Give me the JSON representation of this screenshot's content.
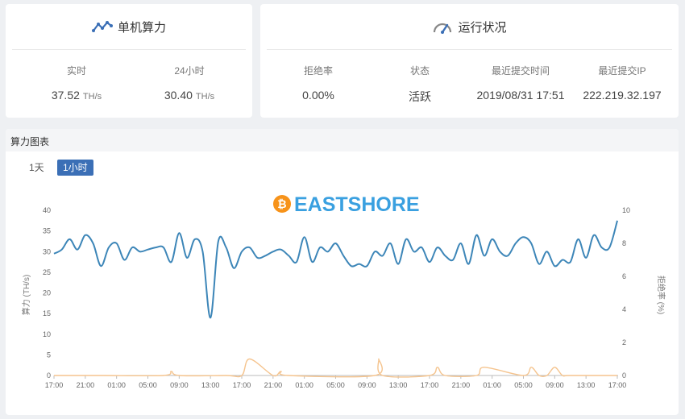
{
  "hashrate_card": {
    "title": "单机算力",
    "icon": "trend-line-icon",
    "realtime": {
      "label": "实时",
      "value": "37.52",
      "unit": "TH/s"
    },
    "day": {
      "label": "24小时",
      "value": "30.40",
      "unit": "TH/s"
    }
  },
  "status_card": {
    "title": "运行状况",
    "icon": "speedometer-icon",
    "columns": [
      {
        "label": "拒绝率",
        "value": "0.00%"
      },
      {
        "label": "状态",
        "value": "活跃"
      },
      {
        "label": "最近提交时间",
        "value": "2019/08/31 17:51"
      },
      {
        "label": "最近提交IP",
        "value": "222.219.32.197"
      }
    ]
  },
  "chart_section": {
    "title": "算力图表",
    "range_buttons": [
      {
        "label": "1天",
        "active": false
      },
      {
        "label": "1小时",
        "active": true
      }
    ],
    "watermark": "EASTSHORE",
    "watermark_icon": "bitcoin-icon"
  },
  "colors": {
    "accent": "#3b6fb6",
    "hashrate_line": "#3d86b8",
    "reject_line": "#f5c48e",
    "watermark_orange": "#f7931a",
    "watermark_blue": "#3aa0e0"
  },
  "chart_data": {
    "type": "line",
    "title": "",
    "xlabel": "",
    "ylabel": "算力 (TH/s)",
    "ylabel_right": "拒绝率 (%)",
    "ylim": [
      0,
      40
    ],
    "ylim_right": [
      0,
      10
    ],
    "yticks": [
      0,
      5,
      10,
      15,
      20,
      25,
      30,
      35,
      40
    ],
    "yticks_right": [
      0,
      2,
      4,
      6,
      8,
      10
    ],
    "xtick_labels": [
      "17:00",
      "21:00",
      "01:00",
      "05:00",
      "09:00",
      "13:00",
      "17:00",
      "21:00",
      "01:00",
      "05:00",
      "09:00",
      "13:00",
      "17:00",
      "21:00",
      "01:00",
      "05:00",
      "09:00",
      "13:00",
      "17:00"
    ],
    "x_hours": [
      0,
      4,
      8,
      12,
      16,
      20,
      24,
      28,
      32,
      36,
      40,
      44,
      48,
      52,
      56,
      60,
      64,
      68,
      72
    ],
    "grid": false,
    "series": [
      {
        "axis": "left",
        "x": [
          0,
          1,
          2,
          3,
          4,
          5,
          6,
          7,
          8,
          9,
          10,
          11,
          12,
          13,
          14,
          15,
          16,
          17,
          18,
          19,
          20,
          21,
          22,
          23,
          24,
          25,
          26,
          27,
          28,
          29,
          30,
          31,
          32,
          33,
          34,
          35,
          36,
          37,
          38,
          39,
          40,
          41,
          42,
          43,
          44,
          45,
          46,
          47,
          48,
          49,
          50,
          51,
          52,
          53,
          54,
          55,
          56,
          57,
          58,
          59,
          60,
          61,
          62,
          63,
          64,
          65,
          66,
          67,
          68,
          69,
          70,
          71,
          72
        ],
        "values": [
          29.5,
          30.5,
          33,
          30.5,
          34,
          32,
          26.5,
          31,
          32,
          28,
          31,
          30,
          30.5,
          31,
          31,
          27.5,
          34.5,
          28.5,
          33,
          30,
          14,
          32.5,
          31,
          26,
          30,
          31,
          28.5,
          29,
          30,
          30.5,
          29,
          27.5,
          33.5,
          27.5,
          31,
          30,
          32,
          29,
          26.5,
          27,
          26.5,
          30,
          29,
          32,
          27,
          33,
          30,
          31,
          27.5,
          31,
          29,
          28,
          32,
          27,
          34,
          29,
          33,
          30,
          29,
          32,
          33.5,
          32,
          27,
          30,
          26.5,
          28,
          27.5,
          33,
          28.5,
          34,
          31,
          31,
          37.5
        ]
      },
      {
        "axis": "right",
        "x": [
          0,
          6,
          14,
          15,
          16,
          22,
          24,
          25,
          28,
          29,
          30,
          41,
          41.5,
          42,
          48,
          49,
          50,
          54,
          55,
          60,
          61,
          62,
          63,
          64,
          65,
          66
        ],
        "values": [
          0,
          0,
          0,
          0.25,
          0,
          0,
          0,
          1,
          0,
          0.25,
          0,
          0,
          1,
          0,
          0,
          0.5,
          0,
          0,
          0.5,
          0,
          0.5,
          0,
          0,
          0.5,
          0,
          0
        ]
      }
    ]
  }
}
